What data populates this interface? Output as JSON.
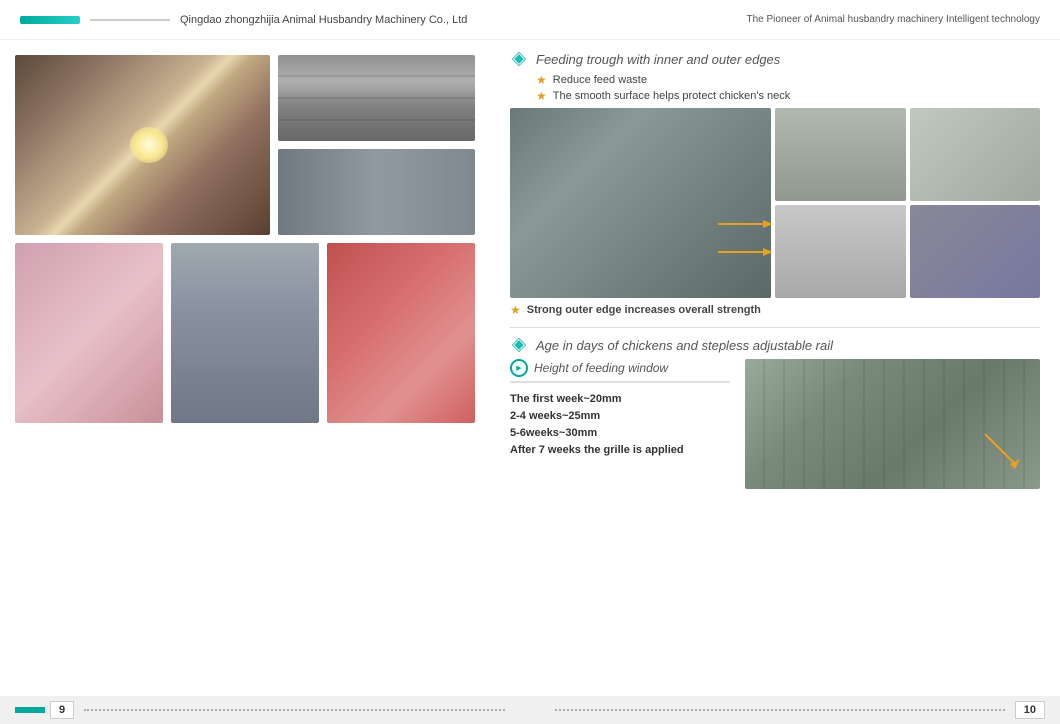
{
  "header": {
    "company": "Qingdao zhongzhijia Animal Husbandry Machinery Co., Ltd",
    "slogan": "The Pioneer of Animal husbandry machinery Intelligent technology"
  },
  "footer": {
    "page_left": "9",
    "page_right": "10"
  },
  "section1": {
    "title": "Feeding trough with inner and outer edges",
    "features": [
      "Reduce feed waste",
      "The smooth surface helps protect chicken's neck"
    ],
    "bottom_note": "Strong outer edge  increases overall strength"
  },
  "section2": {
    "title": "Age in days of chickens and stepless adjustable rail"
  },
  "feeding_window": {
    "title": "Height of feeding window",
    "specs": [
      "The first week~20mm",
      "2-4 weeks~25mm",
      "5-6weeks~30mm",
      "After 7 weeks the grille is applied"
    ]
  }
}
